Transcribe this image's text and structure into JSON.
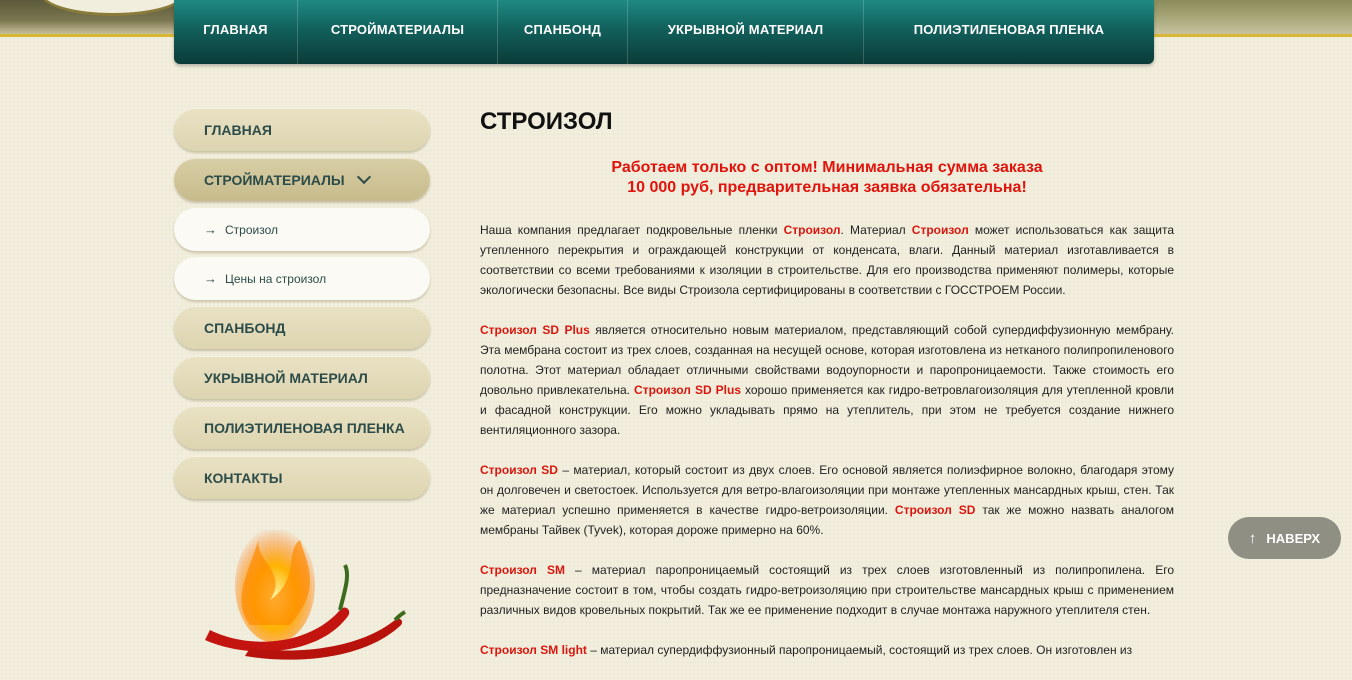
{
  "topnav": {
    "items": [
      "ГЛАВНАЯ",
      "СТРОЙМАТЕРИАЛЫ",
      "СПАНБОНД",
      "УКРЫВНОЙ МАТЕРИАЛ",
      "ПОЛИЭТИЛЕНОВАЯ ПЛЕНКА"
    ]
  },
  "sidebar": {
    "items": {
      "home": "ГЛАВНАЯ",
      "materials": "СТРОЙМАТЕРИАЛЫ",
      "sub1": "Строизол",
      "sub2": "Цены на строизол",
      "spunbond": "СПАНБОНД",
      "covering": "УКРЫВНОЙ МАТЕРИАЛ",
      "film": "ПОЛИЭТИЛЕНОВАЯ ПЛЕНКА",
      "contacts": "КОНТАКТЫ"
    },
    "sub_arrow": "→"
  },
  "main": {
    "title": "СТРОИЗОЛ",
    "notice_line1": "Работаем только с оптом! Минимальная сумма заказа",
    "notice_line2": "10 000 руб, предварительная заявка обязательна!",
    "p1": {
      "a": "Наша компания предлагает подкровельные пленки ",
      "b": "Строизол",
      "c": ". Материал ",
      "d": "Строизол",
      "e": " может использоваться как защита утепленного перекрытия и ограждающей конструкции от конденсата, влаги. Данный материал изготавливается в соответствии со всеми требованиями к изоляции в строительстве. Для его производства применяют полимеры, которые экологически безопасны. Все виды Строизола сертифицированы в соответствии с ГОССТРОЕМ России."
    },
    "p2": {
      "a": "Строизол SD Plus",
      "b": " является относительно новым материалом, представляющий собой супердиффузионную мембрану. Эта мембрана состоит из трех слоев, созданная на несущей основе, которая изготовлена из нетканого полипропиленового полотна. Этот материал обладает отличными свойствами водоупорности и паропроницаемости. Также стоимость его довольно привлекательна. ",
      "c": "Строизол SD Plus",
      "d": " хорошо применяется как гидро-ветровлагоизоляция для утепленной кровли и фасадной конструкции. Его можно укладывать прямо на утеплитель, при этом не требуется создание нижнего вентиляционного зазора."
    },
    "p3": {
      "a": "Строизол SD",
      "b": " – материал, который состоит из двух слоев. Его основой является полиэфирное волокно, благодаря этому он долговечен и светостоек. Используется для ветро-влагоизоляции при монтаже утепленных мансардных крыш, стен. Так же материал успешно применяется в качестве гидро-ветроизоляции. ",
      "c": "Строизол SD",
      "d": " так же можно назвать аналогом мембраны Тайвек (Tyvek), которая дороже примерно на 60%."
    },
    "p4": {
      "a": "Строизол SM",
      "b": " – материал паропроницаемый состоящий из трех слоев изготовленный из полипропилена. Его предназначение состоит в том, чтобы создать гидро-ветроизоляцию при строительстве мансардных крыш с применением различных видов кровельных покрытий. Так же ее применение подходит в случае монтажа наружного утеплителя стен."
    },
    "p5": {
      "a": "Строизол SM light",
      "b": " – материал супердиффузионный паропроницаемый, состоящий из трех слоев. Он изготовлен из"
    }
  },
  "totop": {
    "label": "НАВЕРХ",
    "arrow": "↑"
  },
  "colors": {
    "nav_teal": "#12605c",
    "highlight_red": "#d9170f",
    "sidebar_text": "#2c4c49"
  }
}
